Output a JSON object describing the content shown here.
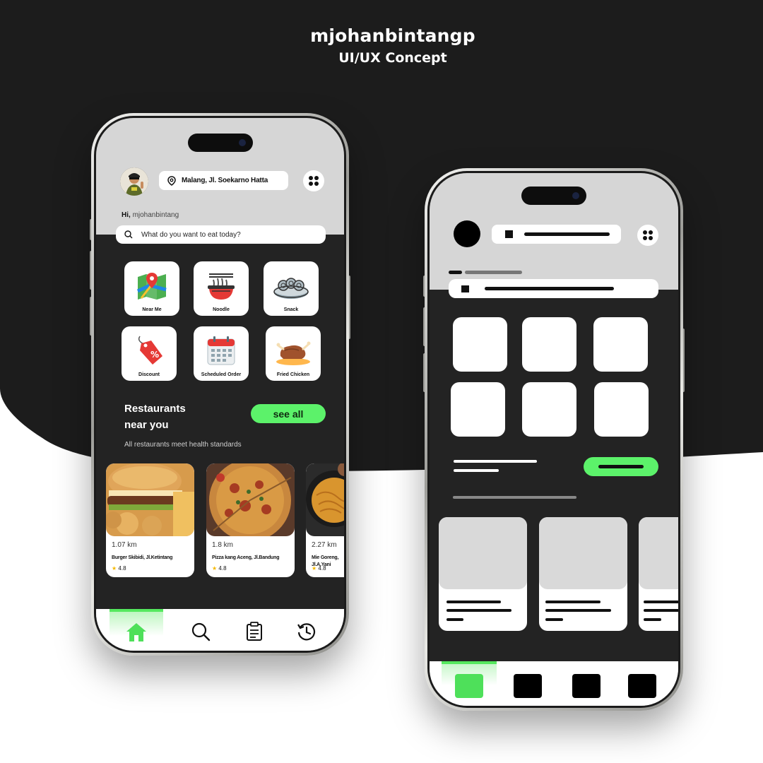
{
  "header": {
    "author": "mjohanbintangp",
    "subtitle": "UI/UX Concept"
  },
  "phone1": {
    "location": "Malang, Jl. Soekarno Hatta",
    "greeting_prefix": "Hi,",
    "username": "mjohanbintang",
    "search_placeholder": "What do you want to eat today?",
    "categories": [
      {
        "label": "Near Me",
        "icon": "map-icon"
      },
      {
        "label": "Noodle",
        "icon": "noodle-bowl-icon"
      },
      {
        "label": "Snack",
        "icon": "snack-icon"
      },
      {
        "label": "Discount",
        "icon": "discount-tag-icon"
      },
      {
        "label": "Scheduled Order",
        "icon": "calendar-icon"
      },
      {
        "label": "Fried Chicken",
        "icon": "fried-chicken-icon"
      }
    ],
    "section_title_line1": "Restaurants",
    "section_title_line2": "near you",
    "see_all_label": "see all",
    "section_subtitle": "All restaurants meet health standards",
    "restaurants": [
      {
        "distance": "1.07 km",
        "name": "Burger Skibidi, Jl.Ketintang",
        "rating": "4.8"
      },
      {
        "distance": "1.8 km",
        "name": "Pizza kang Aceng, Jl.Bandung",
        "rating": "4.8"
      },
      {
        "distance": "2.27 km",
        "name": "Mie Goreng, Jl.A.Yani",
        "rating": "4.8"
      }
    ],
    "nav": [
      "home-icon",
      "search-icon",
      "orders-icon",
      "history-icon"
    ],
    "accent": "#5cf26a"
  },
  "colors": {
    "dark": "#232323",
    "screen_light": "#d6d6d6",
    "accent": "#5cf26a"
  }
}
